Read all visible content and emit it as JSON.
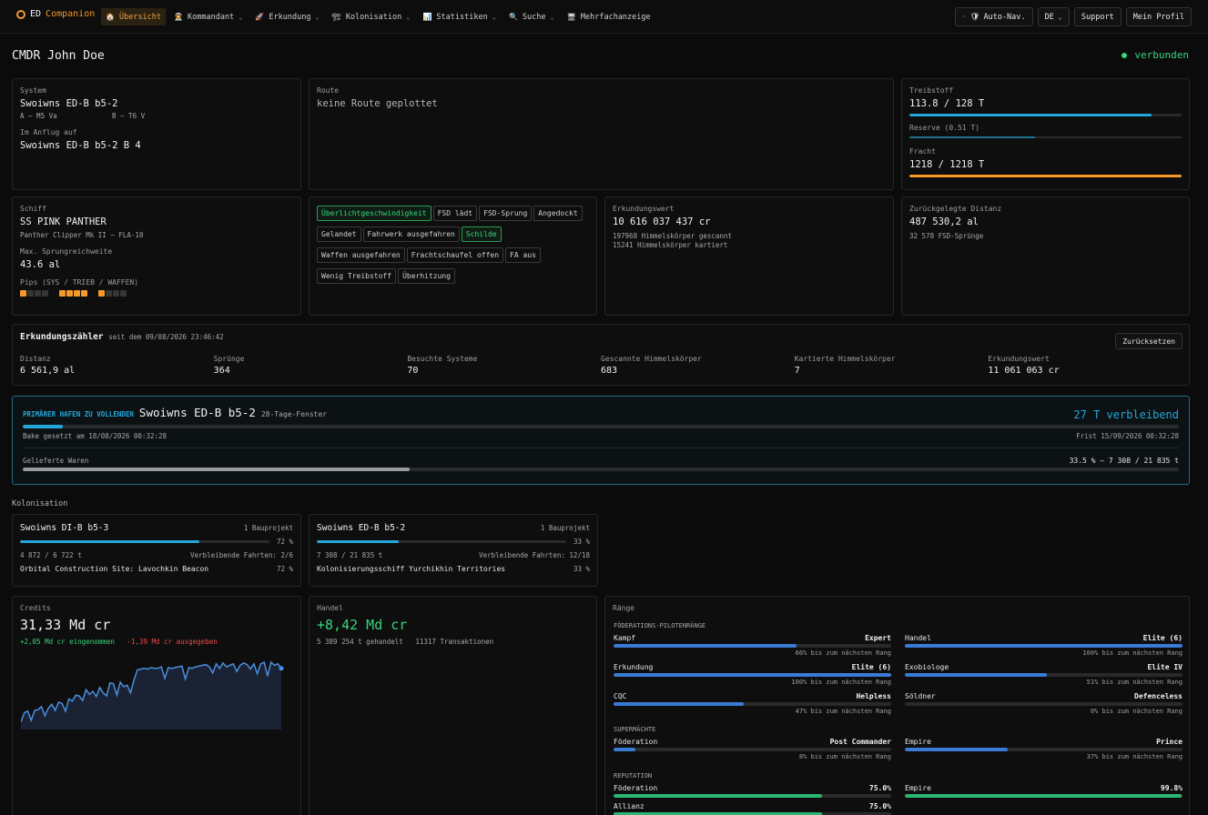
{
  "brand": {
    "name": "ED",
    "accent": "Companion"
  },
  "nav": {
    "items": [
      {
        "label": "Übersicht",
        "icon": "🏠",
        "chev": ""
      },
      {
        "label": "Kommandant",
        "icon": "👨‍🚀",
        "chev": "⌄"
      },
      {
        "label": "Erkundung",
        "icon": "🚀",
        "chev": "⌄"
      },
      {
        "label": "Kolonisation",
        "icon": "🏗",
        "chev": "⌄"
      },
      {
        "label": "Statistiken",
        "icon": "📊",
        "chev": "⌄"
      },
      {
        "label": "Suche",
        "icon": "🔍",
        "chev": "⌄"
      },
      {
        "label": "Mehrfachanzeige",
        "icon": "🖥",
        "chev": ""
      }
    ],
    "auto_nav": "Auto-Nav.",
    "lang": "DE",
    "support": "Support",
    "profile": "Mein Profil"
  },
  "cmdr": "CMDR John Doe",
  "status": "verbunden",
  "system": {
    "label": "System",
    "name": "Swoiwns ED-B b5-2",
    "star_a": "A – M5 Va",
    "star_b": "B – T6 V",
    "approach_label": "Im Anflug auf",
    "approach": "Swoiwns ED-B b5-2 B 4"
  },
  "route": {
    "label": "Route",
    "value": "keine Route geplottet"
  },
  "fuel": {
    "label": "Treibstoff",
    "value": "113.8 / 128 T",
    "pct": 0.889,
    "reserve_label": "Reserve (0.51 T)",
    "reserve_pct": 0.46,
    "cargo_label": "Fracht",
    "cargo_value": "1218 / 1218 T",
    "cargo_pct": 1.0
  },
  "ship": {
    "label": "Schiff",
    "name": "SS PINK PANTHER",
    "type": "Panther Clipper Mk II – FLA-10",
    "jump_label": "Max. Sprungreichweite",
    "jump": "43.6 al",
    "pips_label": "Pips (SYS / TRIEB / WAFFEN)",
    "pips": [
      1,
      4,
      1
    ]
  },
  "flags": [
    {
      "label": "Überlichtgeschwindigkeit",
      "on": true
    },
    {
      "label": "FSD lädt",
      "on": false
    },
    {
      "label": "FSD-Sprung",
      "on": false
    },
    {
      "label": "Angedockt",
      "on": false
    },
    {
      "label": "Gelandet",
      "on": false
    },
    {
      "label": "Fahrwerk ausgefahren",
      "on": false
    },
    {
      "label": "Schilde",
      "on": true
    },
    {
      "label": "Waffen ausgefahren",
      "on": false
    },
    {
      "label": "Frachtschaufel offen",
      "on": false
    },
    {
      "label": "FA aus",
      "on": false
    },
    {
      "label": "Wenig Treibstoff",
      "on": false
    },
    {
      "label": "Überhitzung",
      "on": false
    }
  ],
  "explo": {
    "label": "Erkundungswert",
    "value": "10 616 037 437 cr",
    "scanned": "197968 Himmelskörper gescannt",
    "mapped": "15241 Himmelskörper kartiert"
  },
  "distance": {
    "label": "Zurückgelegte Distanz",
    "value": "487 530,2 al",
    "jumps": "32 578 FSD-Sprünge"
  },
  "counter": {
    "title": "Erkundungszähler",
    "since": "seit dem 09/08/2026 23:46:42",
    "reset": "Zurücksetzen",
    "cols": [
      {
        "label": "Distanz",
        "value": "6 561,9 al"
      },
      {
        "label": "Sprünge",
        "value": "364"
      },
      {
        "label": "Besuchte Systeme",
        "value": "70"
      },
      {
        "label": "Gescannte Himmelskörper",
        "value": "683"
      },
      {
        "label": "Kartierte Himmelskörper",
        "value": "7"
      },
      {
        "label": "Erkundungswert",
        "value": "11 061 063 cr"
      }
    ]
  },
  "port": {
    "kicker": "PRIMÄRER HAFEN ZU VOLLENDEN",
    "name": "Swoiwns ED-B b5-2",
    "window": "28-Tage-Fenster",
    "remaining": "27 T verbleibend",
    "time_pct": 0.035,
    "beacon": "Bake gesetzt am 18/08/2026 00:32:28",
    "deadline": "Frist 15/09/2026 00:32:28",
    "goods_label": "Gelieferte Waren",
    "goods_value": "33.5 % – 7 308 / 21 835 t",
    "goods_pct": 0.335
  },
  "colonisation": {
    "title": "Kolonisation",
    "cards": [
      {
        "name": "Swoiwns DI-B b5-3",
        "projects": "1 Bauprojekt",
        "pct_label": "72 %",
        "pct": 0.72,
        "tons": "4 872 / 6 722 t",
        "trips": "Verbleibende Fahrten: 2/6",
        "site": "Orbital Construction Site: Lavochkin Beacon",
        "site_pct": "72 %"
      },
      {
        "name": "Swoiwns ED-B b5-2",
        "projects": "1 Bauprojekt",
        "pct_label": "33 %",
        "pct": 0.33,
        "tons": "7 308 / 21 835 t",
        "trips": "Verbleibende Fahrten: 12/18",
        "site": "Kolonisierungsschiff Yurchikhin Territories",
        "site_pct": "33 %"
      }
    ]
  },
  "credits": {
    "label": "Credits",
    "value": "31,33 Md cr",
    "earned": "+2,05 Md cr eingenommen",
    "spent": "-1,39 Md cr ausgegeben"
  },
  "trade": {
    "label": "Handel",
    "value": "+8,42 Md cr",
    "tons": "5 389 254 t gehandelt",
    "tx": "11317 Transaktionen"
  },
  "ranks": {
    "title": "Ränge",
    "fed_title": "FÖDERATIONS-PILOTENRÄNGE",
    "fed": [
      {
        "name": "Kampf",
        "rank": "Expert",
        "pct": 0.66,
        "note": "66% bis zum nächsten Rang"
      },
      {
        "name": "Handel",
        "rank": "Elite (6)",
        "pct": 1.0,
        "note": "100% bis zum nächsten Rang"
      },
      {
        "name": "Erkundung",
        "rank": "Elite (6)",
        "pct": 1.0,
        "note": "100% bis zum nächsten Rang"
      },
      {
        "name": "Exobiologe",
        "rank": "Elite IV",
        "pct": 0.51,
        "note": "51% bis zum nächsten Rang"
      },
      {
        "name": "CQC",
        "rank": "Helpless",
        "pct": 0.47,
        "note": "47% bis zum nächsten Rang"
      },
      {
        "name": "Söldner",
        "rank": "Defenceless",
        "pct": 0.0,
        "note": "0% bis zum nächsten Rang"
      }
    ],
    "super_title": "SUPERMÄCHTE",
    "super": [
      {
        "name": "Föderation",
        "rank": "Post Commander",
        "pct": 0.08,
        "note": "8% bis zum nächsten Rang"
      },
      {
        "name": "Empire",
        "rank": "Prince",
        "pct": 0.37,
        "note": "37% bis zum nächsten Rang"
      }
    ],
    "rep_title": "REPUTATION",
    "rep": [
      {
        "name": "Föderation",
        "rank": "75.0%",
        "pct": 0.75
      },
      {
        "name": "Empire",
        "rank": "99.8%",
        "pct": 0.998
      },
      {
        "name": "Allianz",
        "rank": "75.0%",
        "pct": 0.75
      }
    ]
  },
  "colors": {
    "accent": "#f39a2b",
    "green": "#37d67a",
    "blue": "#3a7bd5",
    "cyan": "#25a6d9",
    "red": "#f04a4a"
  },
  "credits_history": [
    0.1,
    0.22,
    0.24,
    0.12,
    0.25,
    0.26,
    0.3,
    0.18,
    0.28,
    0.33,
    0.25,
    0.36,
    0.34,
    0.24,
    0.4,
    0.37,
    0.45,
    0.44,
    0.38,
    0.52,
    0.46,
    0.5,
    0.43,
    0.55,
    0.48,
    0.44,
    0.61,
    0.6,
    0.45,
    0.62,
    0.56,
    0.58,
    0.48,
    0.65,
    0.78,
    0.79,
    0.8,
    0.79,
    0.81,
    0.8,
    0.8,
    0.82,
    0.67,
    0.81,
    0.8,
    0.81,
    0.82,
    0.83,
    0.66,
    0.81,
    0.8,
    0.82,
    0.83,
    0.84,
    0.85,
    0.82,
    0.74,
    0.86,
    0.8,
    0.87,
    0.82,
    0.84,
    0.86,
    0.76,
    0.84,
    0.87,
    0.85,
    0.79,
    0.86,
    0.73,
    0.86,
    0.88,
    0.7,
    0.88,
    0.84,
    0.86,
    0.8
  ]
}
